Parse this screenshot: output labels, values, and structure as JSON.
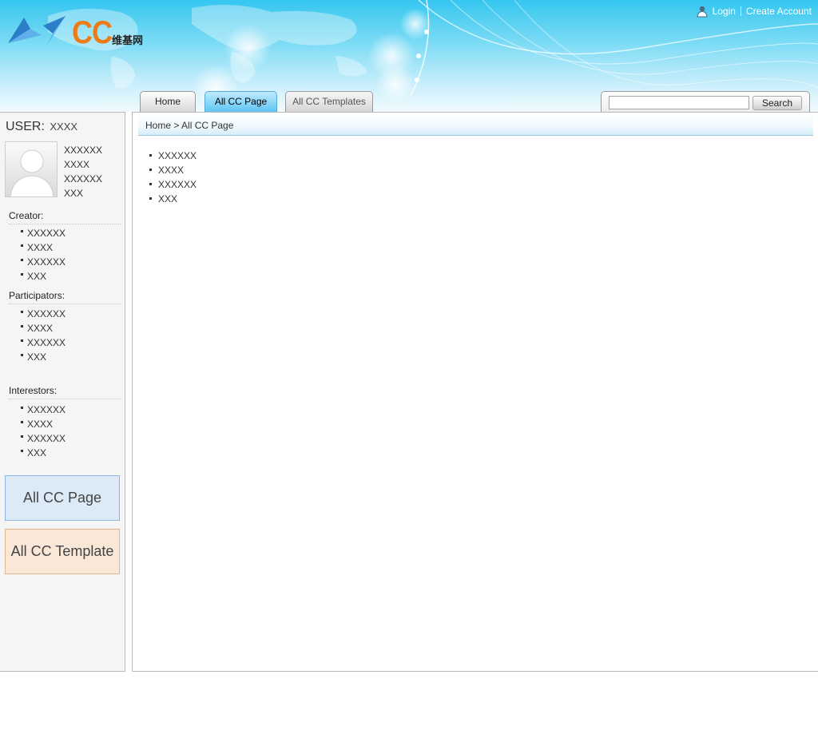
{
  "header": {
    "logo_text": "CC",
    "logo_subtitle": "维基网",
    "links": {
      "login": "Login",
      "create_account": "Create Account"
    }
  },
  "tabs": [
    {
      "label": "Home",
      "active": false
    },
    {
      "label": "All CC Page",
      "active": true
    },
    {
      "label": "All CC Templates",
      "active": false
    }
  ],
  "search": {
    "placeholder": "",
    "button_label": "Search"
  },
  "sidebar": {
    "user_label": "USER:",
    "user_name": "XXXX",
    "user_info": [
      "XXXXXX",
      "XXXX",
      "XXXXXX",
      "XXX"
    ],
    "creator": {
      "title": "Creator:",
      "items": [
        "XXXXXX",
        "XXXX",
        "XXXXXX",
        "XXX"
      ]
    },
    "participators": {
      "title": "Participators:",
      "items": [
        "XXXXXX",
        "XXXX",
        "XXXXXX",
        "XXX"
      ]
    },
    "interestors": {
      "title": "Interestors:",
      "items": [
        "XXXXXX",
        "XXXX",
        "XXXXXX",
        "XXX"
      ]
    },
    "buttons": {
      "all_cc_page": "All CC Page",
      "all_cc_template": "All CC Template"
    }
  },
  "main": {
    "breadcrumb": "Home > All CC Page",
    "items": [
      "XXXXXX",
      "XXXX",
      "XXXXXX",
      "XXX"
    ]
  },
  "colors": {
    "header_sky": "#35c6ef",
    "logo_orange": "#f07a14",
    "active_tab": "#5fc6f2",
    "page_button_bg": "#dce9f7",
    "template_button_bg": "#f9e7d8"
  }
}
